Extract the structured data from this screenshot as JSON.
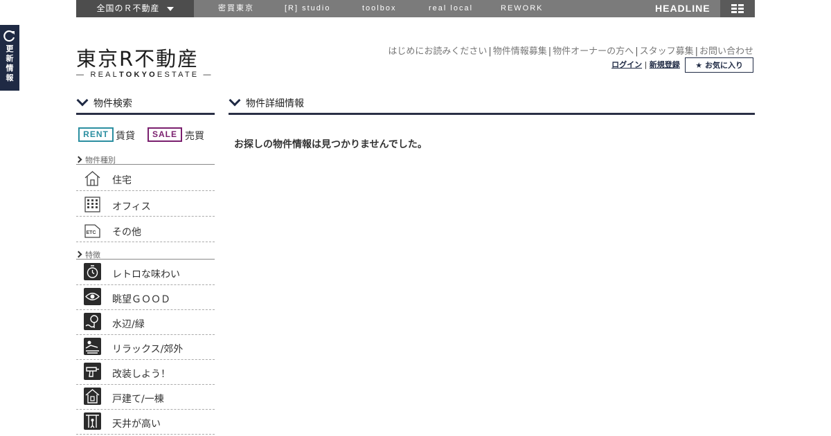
{
  "topbar": {
    "area_select": "全国のＲ不動産",
    "links": [
      "密買東京",
      "[R] studio",
      "toolbox",
      "real local",
      "REWORK"
    ],
    "headline": "HEADLINE"
  },
  "side_tab": {
    "label_lines": [
      "更",
      "新",
      "情",
      "報"
    ]
  },
  "logo": {
    "main": "東京R不動産",
    "sub_prefix": "— REAL",
    "sub_bold": "TOKYO",
    "sub_suffix": "ESTATE —"
  },
  "util_links": [
    "はじめにお読みください",
    "物件情報募集",
    "物件オーナーの方へ",
    "スタッフ募集",
    "お問い合わせ"
  ],
  "login": {
    "login": "ログイン",
    "separator": "|",
    "register": "新規登録",
    "favorites": "★ お気に入り"
  },
  "sidebar": {
    "heading": "物件検索",
    "rent": {
      "badge": "RENT",
      "label": "賃貸"
    },
    "sale": {
      "badge": "SALE",
      "label": "売買"
    },
    "types_label": "物件種別",
    "types": [
      {
        "label": "住宅",
        "icon": "house-icon"
      },
      {
        "label": "オフィス",
        "icon": "office-building-icon"
      },
      {
        "label": "その他",
        "icon": "etc-icon"
      }
    ],
    "features_label": "特徴",
    "features": [
      {
        "label": "レトロな味わい",
        "icon": "retro-clock-icon"
      },
      {
        "label": "眺望ＧＯＯＤ",
        "icon": "eye-view-icon"
      },
      {
        "label": "水辺/緑",
        "icon": "waterside-tree-icon"
      },
      {
        "label": "リラックス/郊外",
        "icon": "relax-icon"
      },
      {
        "label": "改装しよう！",
        "icon": "drill-icon"
      },
      {
        "label": "戸建て/一棟",
        "icon": "detached-house-icon"
      },
      {
        "label": "天井が高い",
        "icon": "high-ceiling-icon"
      }
    ]
  },
  "main": {
    "heading": "物件詳細情報",
    "message": "お探しの物件情報は見つかりませんでした。"
  },
  "colors": {
    "navy": "#1f2a44",
    "rent": "#2a8ea0",
    "sale": "#7a1f6e",
    "topbar": "#7b7b7b"
  }
}
